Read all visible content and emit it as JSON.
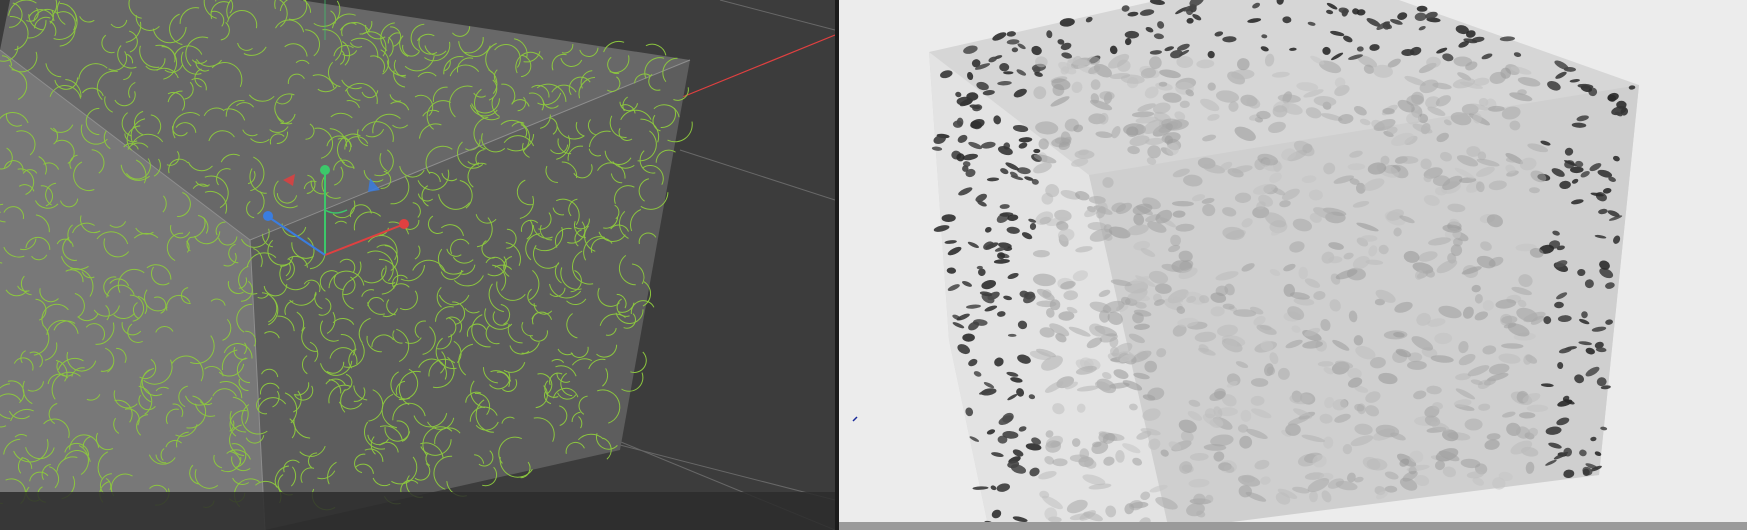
{
  "app": {
    "layout": "split-viewport",
    "panels": [
      {
        "id": "left",
        "kind": "3d-editor-viewport",
        "mode": "wireframe-overlay"
      },
      {
        "id": "right",
        "kind": "render-view",
        "mode": "shaded-render"
      }
    ]
  },
  "colors": {
    "editor_background": "#3c3c3c",
    "editor_floor": "#2b2b2b",
    "grid_line": "#7a7a7a",
    "cube_face_front": "#5d5d5d",
    "cube_face_left": "#787878",
    "cube_face_top": "#686868",
    "fur_guides": "#8cc63f",
    "axis_x": "#e04040",
    "axis_y": "#3cc86a",
    "axis_z": "#3a7de0",
    "render_background": "#ececec",
    "render_cube_light": "#d8d8d8",
    "render_fur_dark": "#3a3a3a"
  },
  "icons": {
    "move_gizmo": "move-gizmo-icon",
    "render_marker": "small-blue-marker-icon"
  }
}
